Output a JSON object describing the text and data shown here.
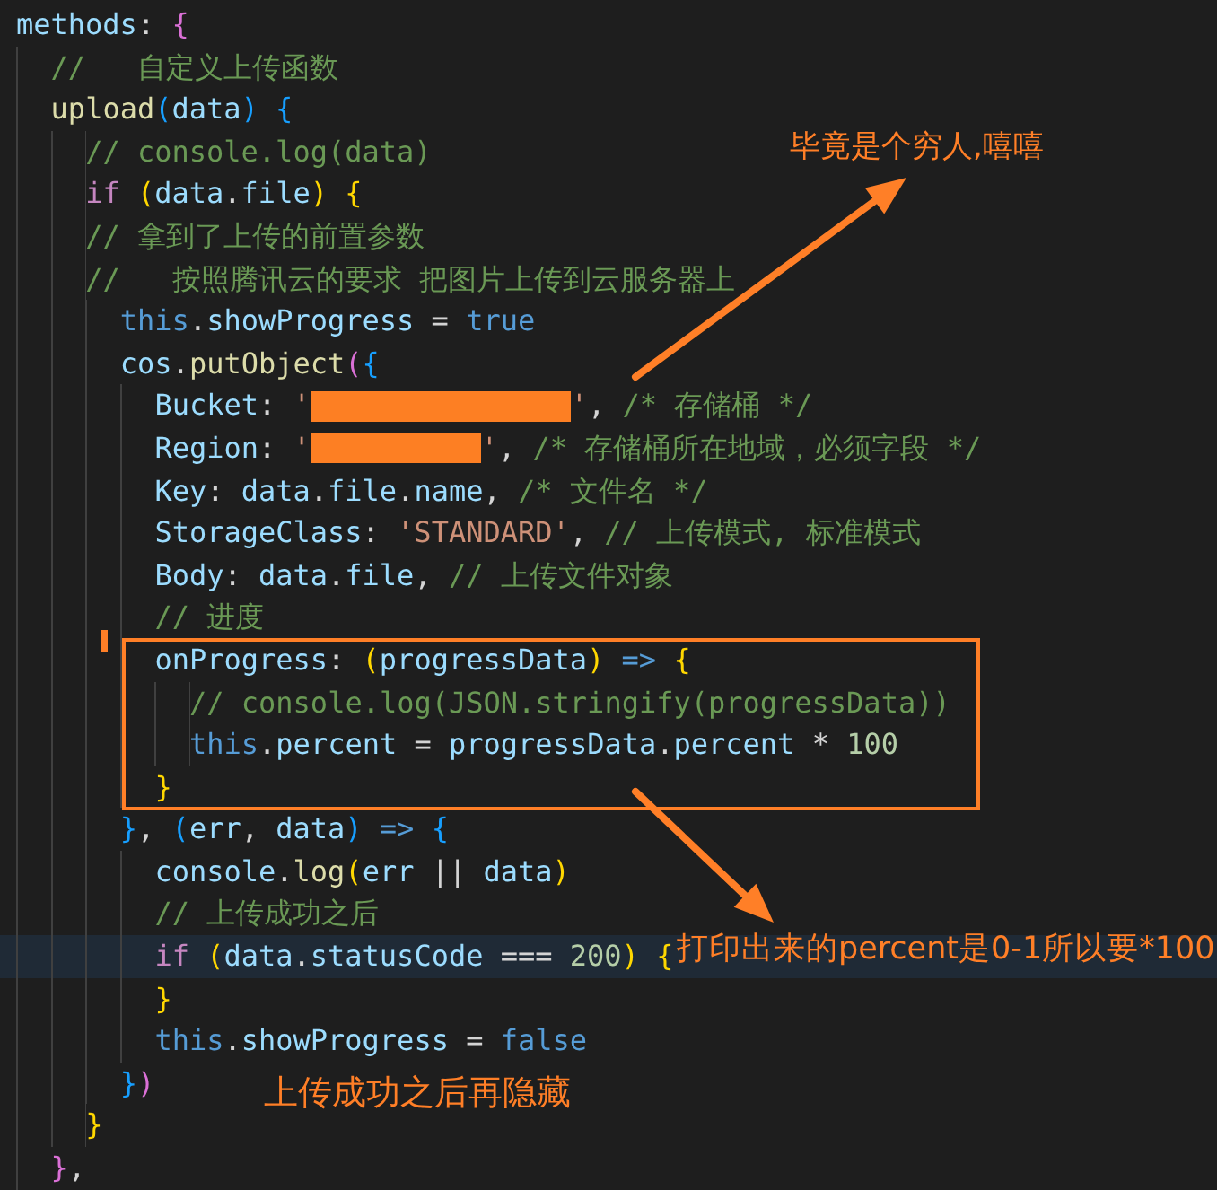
{
  "code_lines": [
    {
      "highlighted": false,
      "tokens": [
        {
          "text": "methods",
          "kind": "prop"
        },
        {
          "text": ": ",
          "kind": "plain"
        },
        {
          "text": "{",
          "kind": "b2"
        }
      ],
      "children": [
        {
          "highlighted": false,
          "tokens": [
            {
              "text": "//   自定义上传函数",
              "kind": "comment"
            }
          ]
        },
        {
          "highlighted": false,
          "tokens": [
            {
              "text": "upload",
              "kind": "fn"
            },
            {
              "text": "(",
              "kind": "b3"
            },
            {
              "text": "data",
              "kind": "prop"
            },
            {
              "text": ") {",
              "kind": "b3"
            }
          ],
          "children": [
            {
              "highlighted": false,
              "tokens": [
                {
                  "text": "// console.log(data)",
                  "kind": "comment"
                }
              ]
            },
            {
              "highlighted": false,
              "tokens": [
                {
                  "text": "if",
                  "kind": "ctrl"
                },
                {
                  "text": " (",
                  "kind": "b1"
                },
                {
                  "text": "data",
                  "kind": "prop"
                },
                {
                  "text": ".",
                  "kind": "plain"
                },
                {
                  "text": "file",
                  "kind": "prop"
                },
                {
                  "text": ") {",
                  "kind": "b1"
                }
              ]
            },
            {
              "highlighted": false,
              "tokens": [
                {
                  "text": "// 拿到了上传的前置参数",
                  "kind": "comment"
                }
              ]
            },
            {
              "highlighted": false,
              "tokens": [
                {
                  "text": "//   按照腾讯云的要求 把图片上传到云服务器上",
                  "kind": "comment"
                }
              ],
              "children": [
                {
                  "highlighted": false,
                  "tokens": [
                    {
                      "text": "this",
                      "kind": "kw"
                    },
                    {
                      "text": ".",
                      "kind": "plain"
                    },
                    {
                      "text": "showProgress",
                      "kind": "prop"
                    },
                    {
                      "text": " = ",
                      "kind": "plain"
                    },
                    {
                      "text": "true",
                      "kind": "kw"
                    }
                  ]
                },
                {
                  "highlighted": false,
                  "tokens": [
                    {
                      "text": "cos",
                      "kind": "prop"
                    },
                    {
                      "text": ".",
                      "kind": "plain"
                    },
                    {
                      "text": "putObject",
                      "kind": "fn"
                    },
                    {
                      "text": "(",
                      "kind": "b2"
                    },
                    {
                      "text": "{",
                      "kind": "b3"
                    }
                  ],
                  "children": [
                    {
                      "highlighted": false,
                      "tokens": [
                        {
                          "text": "Bucket",
                          "kind": "prop"
                        },
                        {
                          "text": ": ",
                          "kind": "plain"
                        },
                        {
                          "text": "'",
                          "kind": "str"
                        },
                        {
                          "kind": "redaction-long"
                        },
                        {
                          "text": "'",
                          "kind": "str"
                        },
                        {
                          "text": ", ",
                          "kind": "plain"
                        },
                        {
                          "text": "/* 存储桶 */",
                          "kind": "comment"
                        }
                      ]
                    },
                    {
                      "highlighted": false,
                      "tokens": [
                        {
                          "text": "Region",
                          "kind": "prop"
                        },
                        {
                          "text": ": ",
                          "kind": "plain"
                        },
                        {
                          "text": "'",
                          "kind": "str"
                        },
                        {
                          "kind": "redaction-short"
                        },
                        {
                          "text": "'",
                          "kind": "str"
                        },
                        {
                          "text": ", ",
                          "kind": "plain"
                        },
                        {
                          "text": "/* 存储桶所在地域，必须字段 */",
                          "kind": "comment"
                        }
                      ]
                    },
                    {
                      "highlighted": false,
                      "tokens": [
                        {
                          "text": "Key",
                          "kind": "prop"
                        },
                        {
                          "text": ": ",
                          "kind": "plain"
                        },
                        {
                          "text": "data",
                          "kind": "prop"
                        },
                        {
                          "text": ".",
                          "kind": "plain"
                        },
                        {
                          "text": "file",
                          "kind": "prop"
                        },
                        {
                          "text": ".",
                          "kind": "plain"
                        },
                        {
                          "text": "name",
                          "kind": "prop"
                        },
                        {
                          "text": ", ",
                          "kind": "plain"
                        },
                        {
                          "text": "/* 文件名 */",
                          "kind": "comment"
                        }
                      ]
                    },
                    {
                      "highlighted": false,
                      "tokens": [
                        {
                          "text": "StorageClass",
                          "kind": "prop"
                        },
                        {
                          "text": ": ",
                          "kind": "plain"
                        },
                        {
                          "text": "'STANDARD'",
                          "kind": "str"
                        },
                        {
                          "text": ", ",
                          "kind": "plain"
                        },
                        {
                          "text": "// 上传模式, 标准模式",
                          "kind": "comment"
                        }
                      ]
                    },
                    {
                      "highlighted": false,
                      "tokens": [
                        {
                          "text": "Body",
                          "kind": "prop"
                        },
                        {
                          "text": ": ",
                          "kind": "plain"
                        },
                        {
                          "text": "data",
                          "kind": "prop"
                        },
                        {
                          "text": ".",
                          "kind": "plain"
                        },
                        {
                          "text": "file",
                          "kind": "prop"
                        },
                        {
                          "text": ", ",
                          "kind": "plain"
                        },
                        {
                          "text": "// 上传文件对象",
                          "kind": "comment"
                        }
                      ]
                    },
                    {
                      "highlighted": false,
                      "tokens": [
                        {
                          "text": "// 进度",
                          "kind": "comment"
                        }
                      ]
                    },
                    {
                      "highlighted": false,
                      "tokens": [
                        {
                          "text": "onProgress",
                          "kind": "prop"
                        },
                        {
                          "text": ": ",
                          "kind": "plain"
                        },
                        {
                          "text": "(",
                          "kind": "b1"
                        },
                        {
                          "text": "progressData",
                          "kind": "prop"
                        },
                        {
                          "text": ")",
                          "kind": "b1"
                        },
                        {
                          "text": " => ",
                          "kind": "kw"
                        },
                        {
                          "text": "{",
                          "kind": "b1"
                        }
                      ],
                      "children": [
                        {
                          "highlighted": false,
                          "tokens": [
                            {
                              "text": "// console.log(JSON.stringify(progressData))",
                              "kind": "comment"
                            }
                          ]
                        },
                        {
                          "highlighted": false,
                          "tokens": [
                            {
                              "text": "this",
                              "kind": "kw"
                            },
                            {
                              "text": ".",
                              "kind": "plain"
                            },
                            {
                              "text": "percent",
                              "kind": "prop"
                            },
                            {
                              "text": " = ",
                              "kind": "plain"
                            },
                            {
                              "text": "progressData",
                              "kind": "prop"
                            },
                            {
                              "text": ".",
                              "kind": "plain"
                            },
                            {
                              "text": "percent",
                              "kind": "prop"
                            },
                            {
                              "text": " * ",
                              "kind": "plain"
                            },
                            {
                              "text": "100",
                              "kind": "num"
                            }
                          ]
                        }
                      ]
                    },
                    {
                      "highlighted": false,
                      "tokens": [
                        {
                          "text": "}",
                          "kind": "b1"
                        }
                      ]
                    }
                  ]
                },
                {
                  "highlighted": false,
                  "tokens": [
                    {
                      "text": "}",
                      "kind": "b3"
                    },
                    {
                      "text": ", ",
                      "kind": "plain"
                    },
                    {
                      "text": "(",
                      "kind": "b3"
                    },
                    {
                      "text": "err",
                      "kind": "prop"
                    },
                    {
                      "text": ", ",
                      "kind": "plain"
                    },
                    {
                      "text": "data",
                      "kind": "prop"
                    },
                    {
                      "text": ")",
                      "kind": "b3"
                    },
                    {
                      "text": " => ",
                      "kind": "kw"
                    },
                    {
                      "text": "{",
                      "kind": "b3"
                    }
                  ],
                  "children": [
                    {
                      "highlighted": false,
                      "tokens": [
                        {
                          "text": "console",
                          "kind": "prop"
                        },
                        {
                          "text": ".",
                          "kind": "plain"
                        },
                        {
                          "text": "log",
                          "kind": "fn"
                        },
                        {
                          "text": "(",
                          "kind": "b1"
                        },
                        {
                          "text": "err",
                          "kind": "prop"
                        },
                        {
                          "text": " || ",
                          "kind": "plain"
                        },
                        {
                          "text": "data",
                          "kind": "prop"
                        },
                        {
                          "text": ")",
                          "kind": "b1"
                        }
                      ]
                    },
                    {
                      "highlighted": false,
                      "tokens": [
                        {
                          "text": "// 上传成功之后",
                          "kind": "comment"
                        }
                      ]
                    },
                    {
                      "highlighted": true,
                      "tokens": [
                        {
                          "text": "if",
                          "kind": "ctrl"
                        },
                        {
                          "text": " (",
                          "kind": "b1"
                        },
                        {
                          "text": "data",
                          "kind": "prop"
                        },
                        {
                          "text": ".",
                          "kind": "plain"
                        },
                        {
                          "text": "statusCode",
                          "kind": "prop"
                        },
                        {
                          "text": " === ",
                          "kind": "plain"
                        },
                        {
                          "text": "200",
                          "kind": "num"
                        },
                        {
                          "text": ") {",
                          "kind": "b1"
                        }
                      ]
                    },
                    {
                      "highlighted": false,
                      "tokens": [
                        {
                          "text": "}",
                          "kind": "b1"
                        }
                      ]
                    },
                    {
                      "highlighted": false,
                      "tokens": [
                        {
                          "text": "this",
                          "kind": "kw"
                        },
                        {
                          "text": ".",
                          "kind": "plain"
                        },
                        {
                          "text": "showProgress",
                          "kind": "prop"
                        },
                        {
                          "text": " = ",
                          "kind": "plain"
                        },
                        {
                          "text": "false",
                          "kind": "kw"
                        }
                      ]
                    }
                  ]
                },
                {
                  "highlighted": false,
                  "tokens": [
                    {
                      "text": "}",
                      "kind": "b3"
                    },
                    {
                      "text": ")",
                      "kind": "b2"
                    }
                  ]
                }
              ]
            },
            {
              "highlighted": false,
              "tokens": [
                {
                  "text": "}",
                  "kind": "b1"
                }
              ]
            }
          ]
        },
        {
          "highlighted": false,
          "tokens": [
            {
              "text": "}",
              "kind": "b2"
            },
            {
              "text": ",",
              "kind": "plain"
            }
          ]
        }
      ]
    }
  ],
  "annotations": [
    {
      "text": "毕竟是个穷人,嘻嘻"
    },
    {
      "text": "打印出来的percent是0-1所以要*100"
    },
    {
      "text": "上传成功之后再隐藏"
    }
  ]
}
